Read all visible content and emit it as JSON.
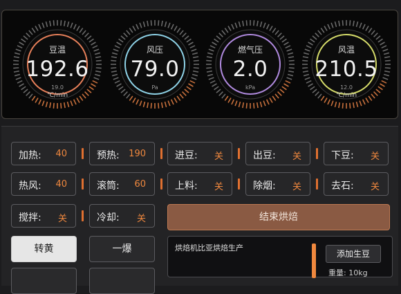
{
  "gauges": [
    {
      "label": "豆温",
      "value": "192.6",
      "sub1": "19.0",
      "sub2": "℃/min",
      "accent": "#e8805a"
    },
    {
      "label": "风压",
      "value": "79.0",
      "sub1": "Pa",
      "sub2": "",
      "accent": "#8fd3e8"
    },
    {
      "label": "燃气压",
      "value": "2.0",
      "sub1": "kPa",
      "sub2": "",
      "accent": "#b18be0"
    },
    {
      "label": "风温",
      "value": "210.5",
      "sub1": "12.0",
      "sub2": "℃/min",
      "accent": "#d6dc6a"
    }
  ],
  "controls": {
    "heat": {
      "label": "加热:",
      "value": "40"
    },
    "preheat": {
      "label": "预热:",
      "value": "190"
    },
    "feed_in": {
      "label": "进豆:",
      "value": "关"
    },
    "feed_out": {
      "label": "出豆:",
      "value": "关"
    },
    "drop": {
      "label": "下豆:",
      "value": "关"
    },
    "fan": {
      "label": "热风:",
      "value": "40"
    },
    "drum": {
      "label": "滚筒:",
      "value": "60"
    },
    "load": {
      "label": "上料:",
      "value": "关"
    },
    "smoke": {
      "label": "除烟:",
      "value": "关"
    },
    "stone": {
      "label": "去石:",
      "value": "关"
    },
    "stir": {
      "label": "搅拌:",
      "value": "关"
    },
    "cool": {
      "label": "冷却:",
      "value": "关"
    }
  },
  "end_roast_label": "结束烘焙",
  "mode_buttons": {
    "a": "转黄",
    "b": "一爆"
  },
  "log": {
    "text": "烘焙机比亚烘焙生产",
    "add_button": "添加生豆",
    "weight": "重量: 10kg"
  },
  "colors": {
    "accent": "#f0883e",
    "end_button": "#8a5a43"
  }
}
